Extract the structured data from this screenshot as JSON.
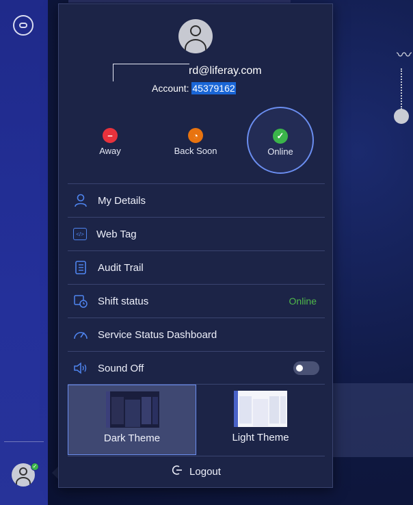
{
  "user": {
    "email": "rd@liferay.com",
    "account_label": "Account:",
    "account_number": "45379162"
  },
  "status": {
    "away": "Away",
    "back_soon": "Back Soon",
    "online": "Online"
  },
  "menu": {
    "my_details": "My Details",
    "web_tag": "Web Tag",
    "web_tag_icon": "</>",
    "audit_trail": "Audit Trail",
    "shift_status": "Shift status",
    "shift_status_value": "Online",
    "service_status": "Service Status Dashboard",
    "sound": "Sound Off"
  },
  "themes": {
    "dark": "Dark Theme",
    "light": "Light Theme"
  },
  "logout": {
    "label": "Logout"
  },
  "colors": {
    "away": "#e8323c",
    "back_soon": "#e8730f",
    "online": "#3bb54a",
    "accent": "#4f85f0"
  }
}
